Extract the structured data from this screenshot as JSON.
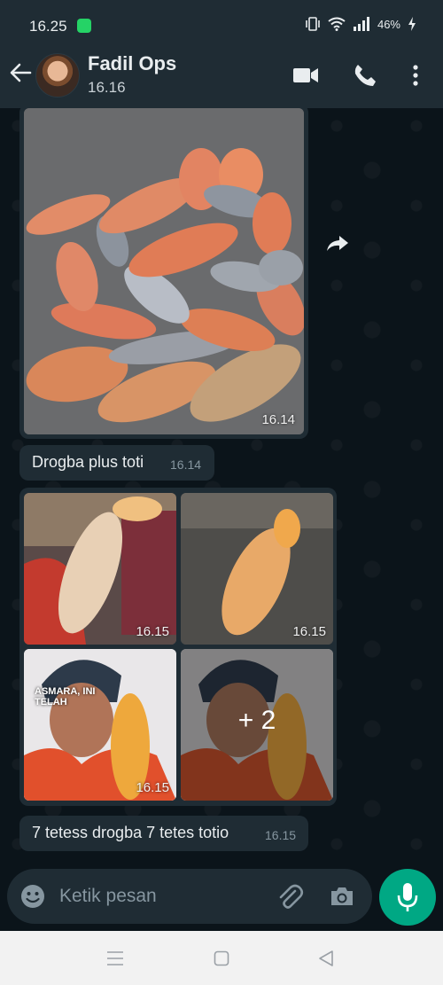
{
  "status_bar": {
    "time": "16.25",
    "battery": "46%"
  },
  "header": {
    "contact_name": "Fadil Ops",
    "status": "16.16"
  },
  "messages": [
    {
      "type": "image",
      "time": "16.14"
    },
    {
      "type": "text",
      "text": "Drogba plus toti",
      "time": "16.14"
    },
    {
      "type": "album",
      "tiles": [
        {
          "time": "16.15"
        },
        {
          "time": "16.15"
        },
        {
          "time": "16.15",
          "overlay_text": "ASMARA, INI TELAH"
        },
        {
          "more_label": "+ 2"
        }
      ]
    },
    {
      "type": "text",
      "text": "7 tetess drogba 7 tetes totio",
      "time": "16.15"
    }
  ],
  "input": {
    "placeholder": "Ketik pesan"
  },
  "colors": {
    "header_bg": "#1f2c34",
    "chat_bg": "#0b141a",
    "bubble_bg": "#1f2c34",
    "accent": "#00a884"
  },
  "icons": [
    "back-arrow-icon",
    "video-call-icon",
    "phone-icon",
    "more-vert-icon",
    "forward-icon",
    "emoji-icon",
    "attach-icon",
    "camera-icon",
    "mic-icon",
    "nav-menu-icon",
    "nav-home-icon",
    "nav-back-icon"
  ]
}
